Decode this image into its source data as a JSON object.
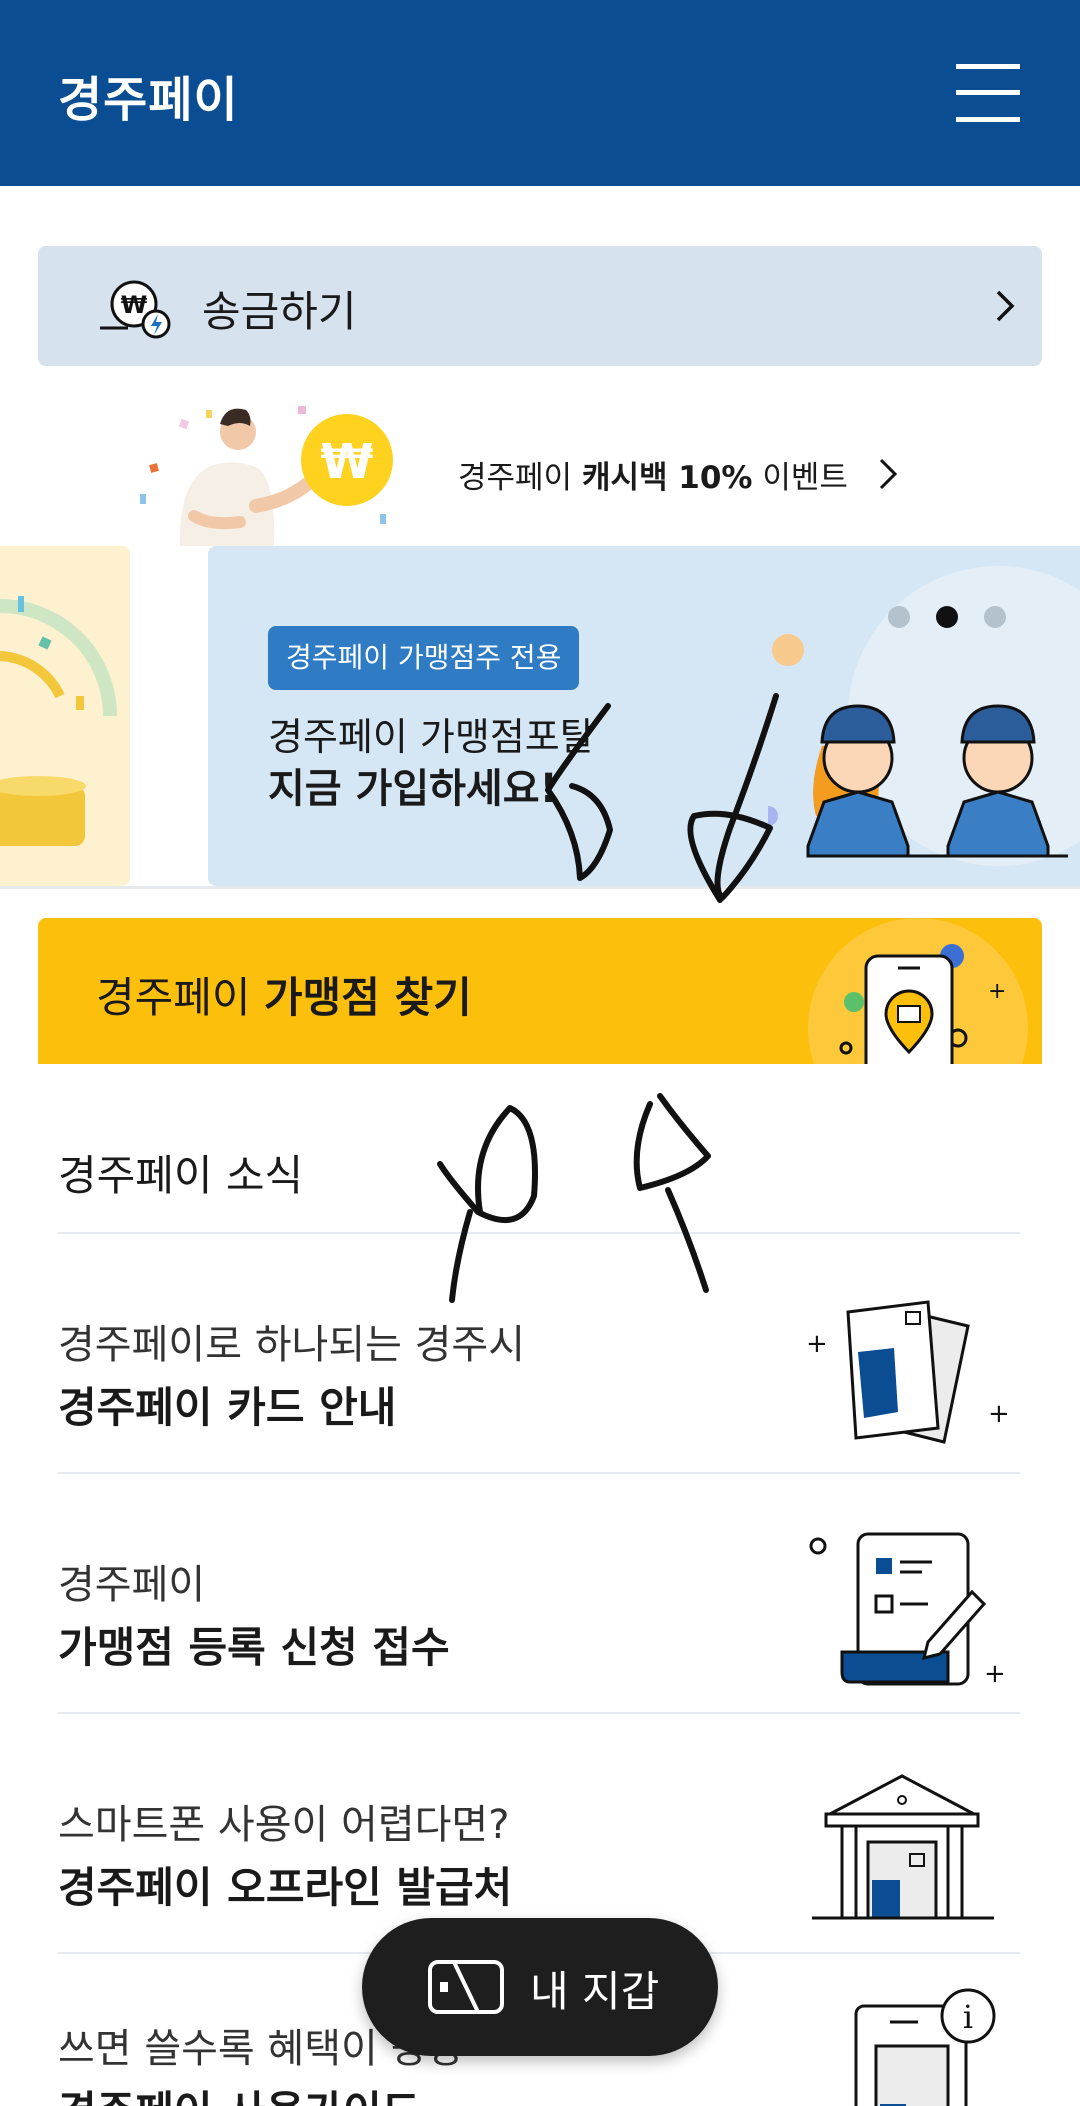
{
  "header": {
    "title": "경주페이",
    "menu_icon": "hamburger-menu-icon"
  },
  "remit": {
    "label": "송금하기",
    "icon": "won-transfer-icon"
  },
  "event_banner": {
    "prefix": "경주페이 ",
    "highlight": "캐시백 10%",
    "suffix": " 이벤트",
    "coin_symbol": "₩"
  },
  "carousel": {
    "tag": "경주페이 가맹점주 전용",
    "line1": "경주페이 가맹점포탈",
    "line2": "지금 가입하세요!",
    "pages": 3,
    "active_page": 2
  },
  "find_store": {
    "prefix": "경주페이 ",
    "highlight": "가맹점 찾기"
  },
  "news": {
    "title": "경주페이 소식",
    "items": [
      {
        "sub": "경주페이로 하나되는 경주시",
        "main": "경주페이 카드 안내"
      },
      {
        "sub": "경주페이",
        "main": "가맹점 등록 신청 접수"
      },
      {
        "sub": "스마트폰 사용이 어렵다면?",
        "main": "경주페이 오프라인 발급처"
      },
      {
        "sub": "쓰면 쓸수록 혜택이 팡팡",
        "main": "경주페이 사용가이드"
      }
    ]
  },
  "wallet_button": {
    "label": "내 지갑"
  },
  "colors": {
    "header": "#0a4d92",
    "accent_yellow": "#fcbf0c",
    "remit_bg": "#d6e3ee",
    "slide_bg": "#d5e7f5",
    "tag": "#2f7cc4"
  }
}
